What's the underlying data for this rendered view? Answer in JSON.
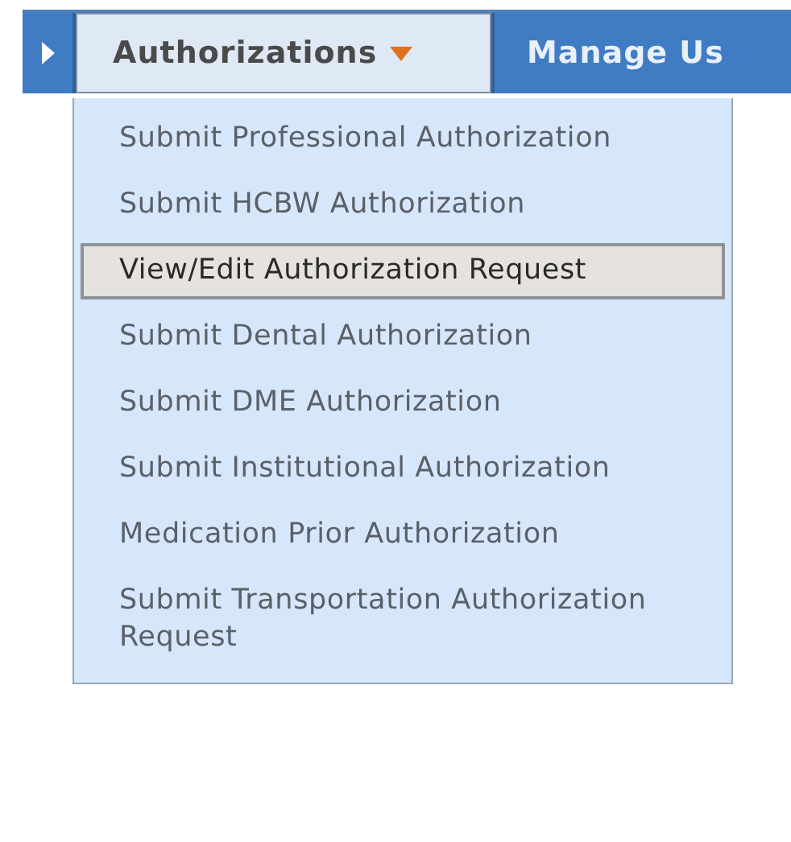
{
  "menu_bar": {
    "items": [
      {
        "kind": "arrow",
        "selected": false
      },
      {
        "kind": "dropdown",
        "label": "Authorizations",
        "selected": true
      },
      {
        "kind": "tab",
        "label": "Manage Us",
        "selected": false
      }
    ]
  },
  "dropdown": {
    "items": [
      {
        "label": "Submit Professional Authorization",
        "selected": false
      },
      {
        "label": "Submit HCBW Authorization",
        "selected": false
      },
      {
        "label": "View/Edit Authorization Request",
        "selected": true
      },
      {
        "label": "Submit Dental Authorization",
        "selected": false
      },
      {
        "label": "Submit DME Authorization",
        "selected": false
      },
      {
        "label": "Submit Institutional Authorization",
        "selected": false
      },
      {
        "label": "Medication Prior Authorization",
        "selected": false
      },
      {
        "label": "Submit Transportation Authorization Request",
        "selected": false
      }
    ]
  }
}
